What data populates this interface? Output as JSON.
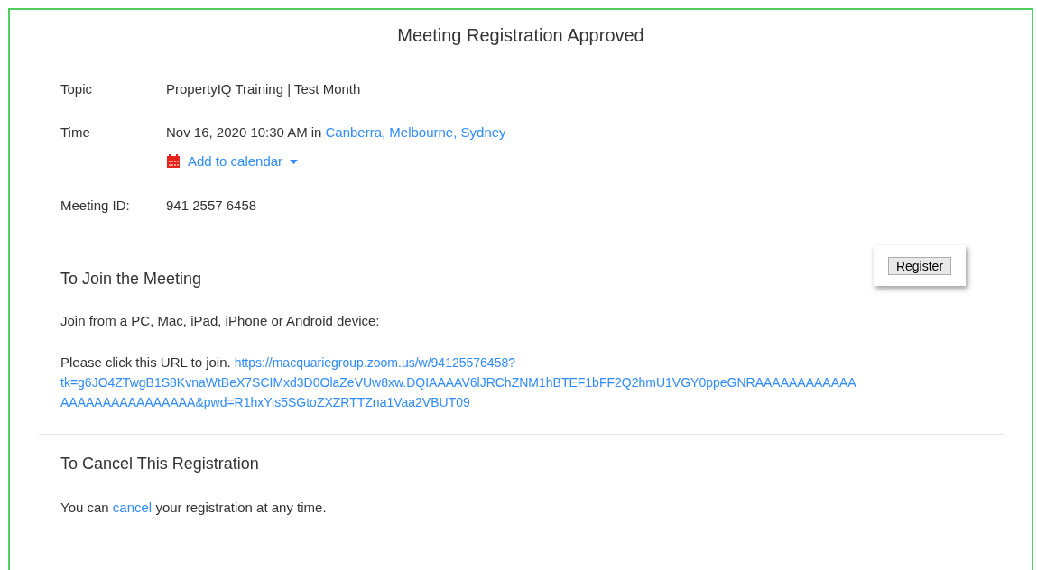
{
  "title": "Meeting Registration Approved",
  "details": [
    {
      "label": "Topic",
      "value": "PropertyIQ Training | Test Month"
    },
    {
      "label": "Time",
      "value": "Nov 16, 2020 10:30 AM",
      "joiner": "in",
      "link": "Canberra, Melbourne, Sydney",
      "action": "Add to calendar"
    },
    {
      "label": "Meeting ID:",
      "value": "941 2557 6458"
    }
  ],
  "register_button": "Register",
  "join": {
    "heading": "To Join the Meeting",
    "devices": "Join from a PC, Mac, iPad, iPhone or Android device:",
    "prompt": "Please click this URL to join.",
    "url_lines": [
      "https://macquariegroup.zoom.us/w/94125576458?",
      "tk=g6JO4ZTwgB1S8KvnaWtBeX7SCIMxd3D0OlaZeVUw8xw.DQIAAAAV6lJRChZNM1hBTEF1bFF2Q2hmU1VGY0ppeGNRAAAAAAAAAAAA",
      "AAAAAAAAAAAAAAAA&pwd=R1hxYis5SGtoZXZRTTZna1Vaa2VBUT09"
    ]
  },
  "cancel": {
    "heading": "To Cancel This Registration",
    "before": "You can",
    "link": "cancel",
    "after": "your registration at any time."
  }
}
